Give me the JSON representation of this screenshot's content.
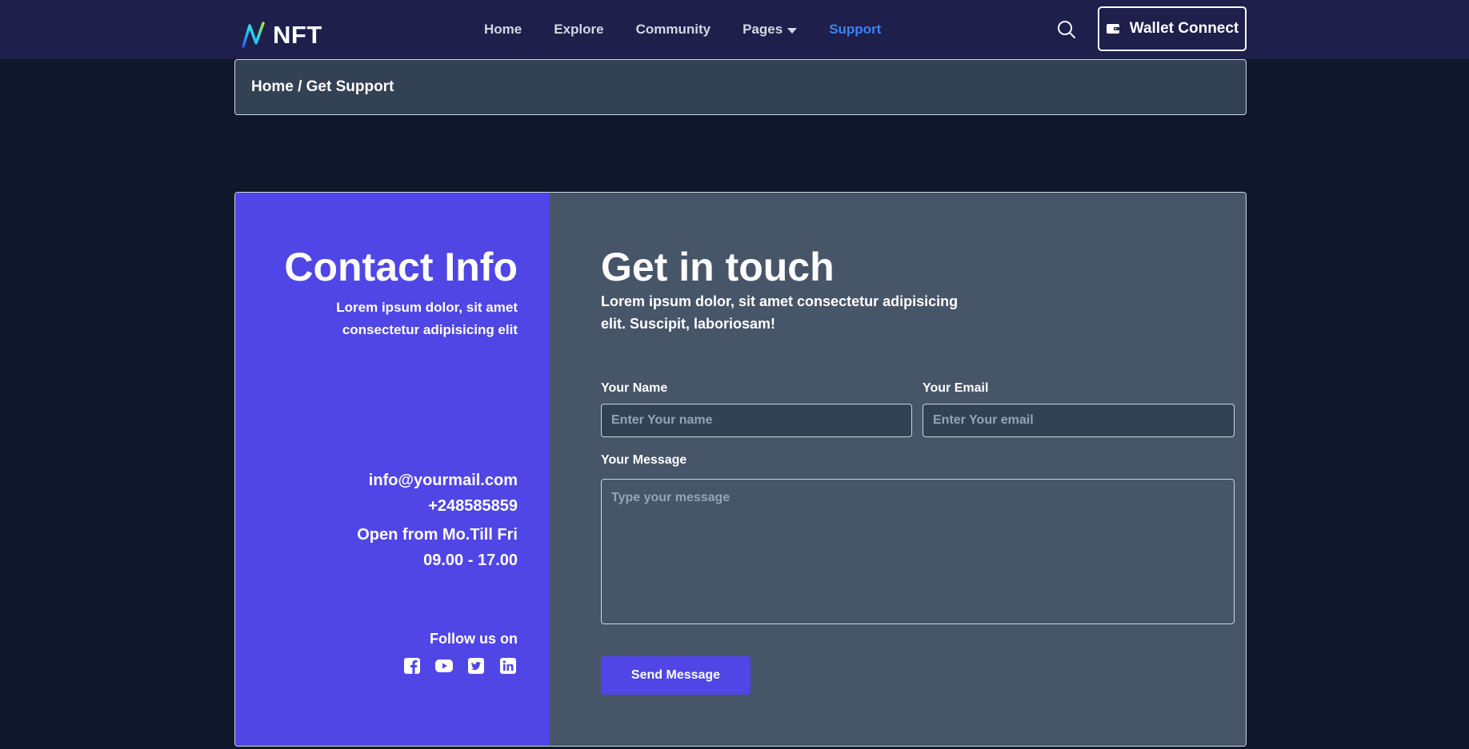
{
  "nav": {
    "logo_text": "NFT",
    "links": [
      {
        "label": "Home"
      },
      {
        "label": "Explore"
      },
      {
        "label": "Community"
      },
      {
        "label": "Pages"
      },
      {
        "label": "Support"
      }
    ],
    "active_link": "Support",
    "wallet_label": "Wallet Connect"
  },
  "breadcrumb": "Home / Get Support",
  "contact_info": {
    "title": "Contact Info",
    "subtitle": "Lorem ipsum dolor, sit amet consectetur adipisicing elit",
    "email": "info@yourmail.com",
    "phone": "+248585859",
    "open_days": "Open from Mo.Till Fri",
    "hours": "09.00 - 17.00",
    "follow_label": "Follow us on",
    "socials": [
      "facebook-icon",
      "youtube-icon",
      "twitter-icon",
      "linkedin-icon"
    ]
  },
  "form": {
    "title": "Get in touch",
    "subtitle": "Lorem ipsum dolor, sit amet consectetur adipisicing elit. Suscipit, laboriosam!",
    "name_label": "Your Name",
    "name_placeholder": "Enter Your name",
    "email_label": "Your Email",
    "email_placeholder": "Enter Your email",
    "message_label": "Your Message",
    "message_placeholder": "Type your message",
    "send_label": "Send Message"
  },
  "colors": {
    "navbar_bg": "#1e1f4b",
    "page_bg": "#0f172a",
    "accent": "#4f46e5",
    "active_link": "#3b82f6",
    "form_bg": "#475569",
    "breadcrumb_bg": "#334155"
  }
}
